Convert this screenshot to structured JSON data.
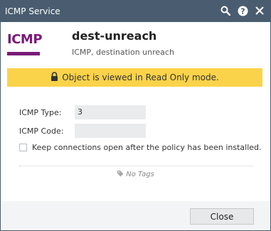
{
  "window": {
    "title": "ICMP Service",
    "icons": [
      "search-icon",
      "help-icon",
      "close-icon"
    ]
  },
  "header": {
    "logo_text": "ICMP",
    "name": "dest-unreach",
    "description": "ICMP, destination unreach"
  },
  "banner": {
    "text": "Object is viewed in Read Only mode."
  },
  "form": {
    "icmp_type_label": "ICMP Type:",
    "icmp_type_value": "3",
    "icmp_code_label": "ICMP Code:",
    "icmp_code_value": "",
    "keep_connections_label": "Keep connections open after the policy has been installed.",
    "keep_connections_checked": false
  },
  "tags": {
    "text": "No Tags"
  },
  "footer": {
    "close_label": "Close"
  },
  "colors": {
    "titlebar": "#4a5d70",
    "logo": "#7a1a78",
    "banner": "#fbd34a"
  }
}
